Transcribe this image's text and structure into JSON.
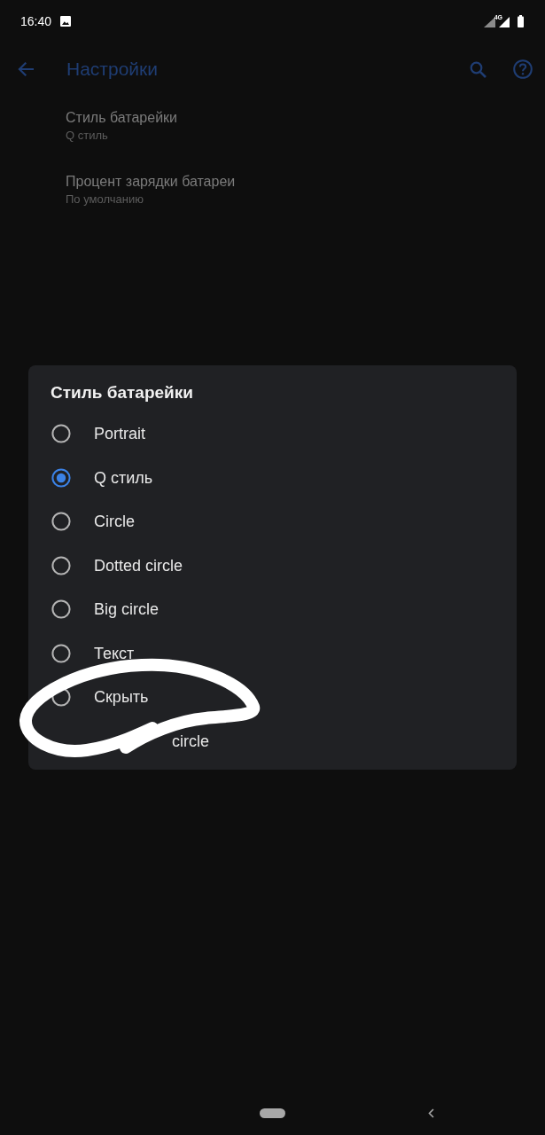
{
  "status_bar": {
    "time": "16:40",
    "network_label": "4G"
  },
  "app_bar": {
    "title": "Настройки"
  },
  "settings": [
    {
      "title": "Стиль батарейки",
      "summary": "Q стиль"
    },
    {
      "title": "Процент зарядки батареи",
      "summary": "По умолчанию"
    }
  ],
  "dialog": {
    "title": "Стиль батарейки",
    "options": [
      {
        "label": "Portrait",
        "selected": false,
        "kind": "normal"
      },
      {
        "label": "Q стиль",
        "selected": true,
        "kind": "normal"
      },
      {
        "label": "Circle",
        "selected": false,
        "kind": "normal"
      },
      {
        "label": "Dotted circle",
        "selected": false,
        "kind": "normal"
      },
      {
        "label": "Big circle",
        "selected": false,
        "kind": "normal"
      },
      {
        "label": "Текст",
        "selected": false,
        "kind": "normal"
      },
      {
        "label": "Скрыть",
        "selected": false,
        "kind": "normal"
      },
      {
        "label": "circle",
        "selected": false,
        "kind": "obscured"
      }
    ]
  }
}
